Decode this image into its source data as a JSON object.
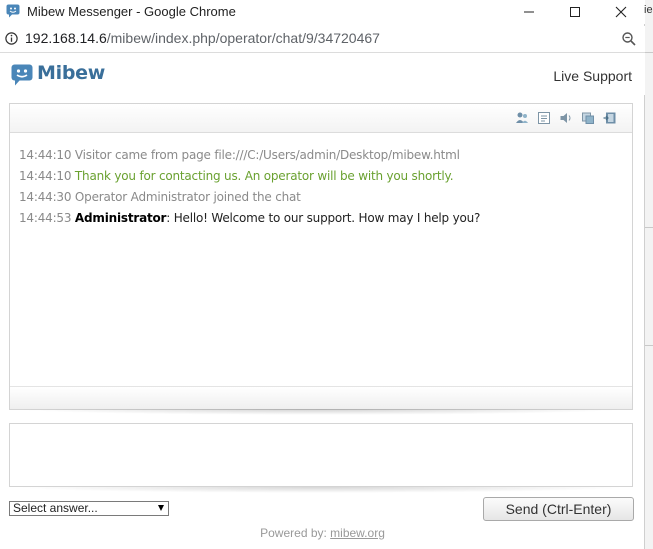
{
  "window": {
    "title": "Mibew Messenger - Google Chrome"
  },
  "address": {
    "host": "192.168.14.6",
    "path": "/mibew/index.php/operator/chat/9/34720467"
  },
  "header": {
    "logo_text": "Mibew",
    "live_support": "Live Support"
  },
  "toolbar": {
    "icons": [
      "user-icon",
      "history-icon",
      "sound-icon",
      "refresh-icon",
      "close-chat-icon"
    ]
  },
  "messages": [
    {
      "time": "14:44:10",
      "text": "Visitor came from page file:///C:/Users/admin/Desktop/mibew.html",
      "kind": "info"
    },
    {
      "time": "14:44:10",
      "text": "Thank you for contacting us. An operator will be with you shortly.",
      "kind": "system"
    },
    {
      "time": "14:44:30",
      "text": "Operator Administrator joined the chat",
      "kind": "info"
    },
    {
      "time": "14:44:53",
      "author": "Administrator",
      "text": ": Hello! Welcome to our support. How may I help you?",
      "kind": "operator"
    }
  ],
  "compose": {
    "value": ""
  },
  "answers": {
    "selected": "Select answer..."
  },
  "send": {
    "label": "Send (Ctrl-Enter)"
  },
  "footer": {
    "powered_prefix": "Powered by:",
    "powered_link": "mibew.org"
  },
  "behind_window": {
    "fragment": "ie"
  },
  "colors": {
    "brand": "#3a6f9a",
    "system_message": "#6aa130",
    "info_message": "#8a8a8a"
  }
}
